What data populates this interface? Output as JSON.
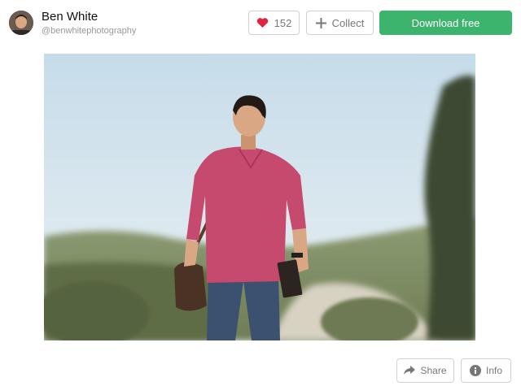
{
  "author": {
    "name": "Ben White",
    "handle": "@benwhitephotography"
  },
  "actions": {
    "like_count": "152",
    "collect_label": "Collect",
    "download_label": "Download free",
    "share_label": "Share",
    "info_label": "Info"
  },
  "icons": {
    "like": "heart-icon",
    "collect": "plus-icon",
    "share": "share-arrow-icon",
    "info": "info-icon"
  },
  "colors": {
    "download_bg": "#3cb46e",
    "heart": "#e0243b",
    "border": "#d1d1d1"
  }
}
